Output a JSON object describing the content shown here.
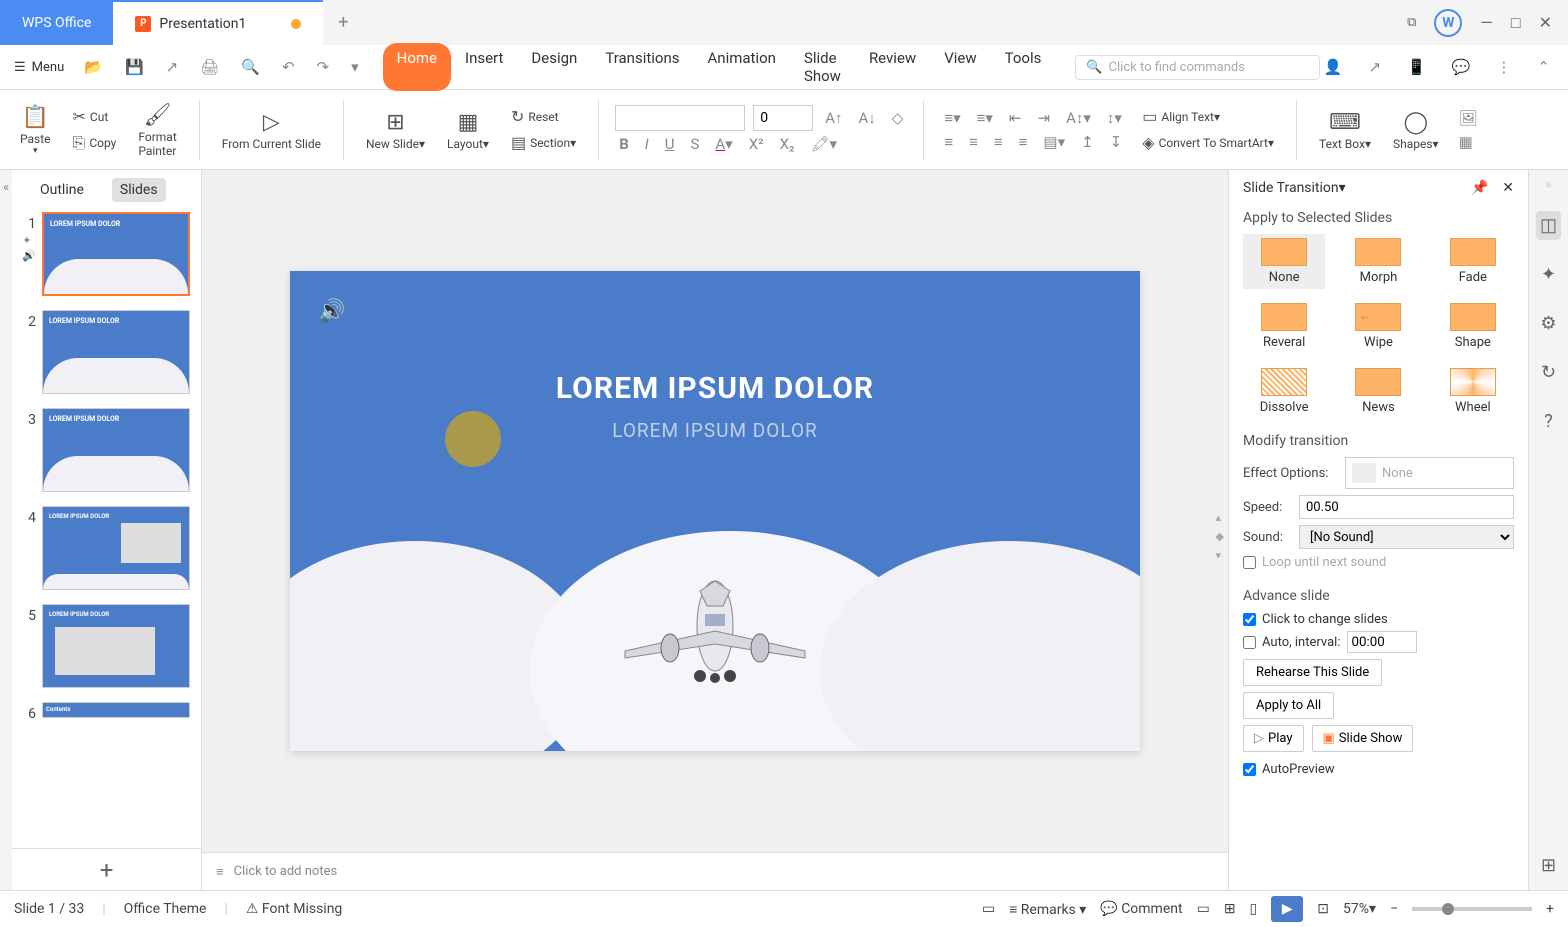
{
  "titlebar": {
    "brand": "WPS Office",
    "doc_tab": "Presentation1"
  },
  "menubar": {
    "menu_label": "Menu",
    "tabs": [
      "Home",
      "Insert",
      "Design",
      "Transitions",
      "Animation",
      "Slide Show",
      "Review",
      "View",
      "Tools"
    ],
    "active_tab": "Home",
    "search_placeholder": "Click to find commands"
  },
  "ribbon": {
    "paste": "Paste",
    "cut": "Cut",
    "copy": "Copy",
    "format_painter": "Format\nPainter",
    "from_current": "From Current Slide",
    "new_slide": "New Slide",
    "layout": "Layout",
    "reset": "Reset",
    "section": "Section",
    "font_size": "0",
    "align_text": "Align Text",
    "convert_smartart": "Convert To SmartArt",
    "text_box": "Text Box",
    "shapes": "Shapes"
  },
  "slidespanel": {
    "outline": "Outline",
    "slides": "Slides",
    "thumbs": [
      {
        "n": "1",
        "txt": "LOREM IPSUM DOLOR"
      },
      {
        "n": "2",
        "txt": "LOREM IPSUM DOLOR"
      },
      {
        "n": "3",
        "txt": "LOREM IPSUM DOLOR"
      },
      {
        "n": "4",
        "txt": "LOREM IPSUM DOLOR"
      },
      {
        "n": "5",
        "txt": "LOREM IPSUM DOLOR"
      },
      {
        "n": "6",
        "txt": "Contents"
      }
    ]
  },
  "slide": {
    "title": "LOREM IPSUM DOLOR",
    "subtitle": "LOREM IPSUM DOLOR"
  },
  "notes_placeholder": "Click to add notes",
  "transition": {
    "panel_title": "Slide Transition",
    "apply_header": "Apply to Selected Slides",
    "items": [
      "None",
      "Morph",
      "Fade",
      "Reveral",
      "Wipe",
      "Shape",
      "Dissolve",
      "News",
      "Wheel"
    ],
    "modify_header": "Modify transition",
    "effect_label": "Effect Options:",
    "effect_value": "None",
    "speed_label": "Speed:",
    "speed_value": "00.50",
    "sound_label": "Sound:",
    "sound_value": "[No Sound]",
    "loop_label": "Loop until next sound",
    "advance_header": "Advance slide",
    "click_label": "Click to change slides",
    "auto_label": "Auto, interval:",
    "auto_value": "00:00",
    "rehearse": "Rehearse This Slide",
    "apply_all": "Apply to All",
    "play": "Play",
    "slideshow": "Slide Show",
    "autopreview": "AutoPreview"
  },
  "statusbar": {
    "slide_count": "Slide 1 / 33",
    "theme": "Office Theme",
    "font_warn": "Font Missing",
    "remarks": "Remarks",
    "comment": "Comment",
    "zoom": "57%"
  }
}
